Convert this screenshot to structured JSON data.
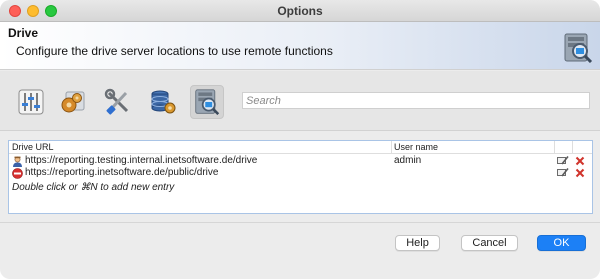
{
  "window": {
    "title": "Options"
  },
  "header": {
    "title": "Drive",
    "description": "Configure the drive server locations to use remote functions",
    "icon": "drive-server-icon"
  },
  "toolbar": {
    "tools": [
      {
        "name": "general-settings",
        "icon": "sliders-icon",
        "selected": false
      },
      {
        "name": "plugins",
        "icon": "gears-icon",
        "selected": false
      },
      {
        "name": "tools",
        "icon": "tools-icon",
        "selected": false
      },
      {
        "name": "database",
        "icon": "database-icon",
        "selected": false
      },
      {
        "name": "drive",
        "icon": "drive-server-icon",
        "selected": true
      }
    ],
    "search_placeholder": "Search"
  },
  "table": {
    "columns": [
      "Drive URL",
      "User name"
    ],
    "rows": [
      {
        "url": "https://reporting.testing.internal.inetsoftware.de/drive",
        "user": "admin",
        "status_icon": "user-icon"
      },
      {
        "url": "https://reporting.inetsoftware.de/public/drive",
        "user": "",
        "status_icon": "no-entry-icon"
      }
    ],
    "hint": "Double click or ⌘N to add new entry"
  },
  "buttons": {
    "help": "Help",
    "cancel": "Cancel",
    "ok": "OK"
  },
  "colors": {
    "accent": "#1c80f6",
    "delete": "#d0342c",
    "table_border": "#a9c4e6"
  }
}
